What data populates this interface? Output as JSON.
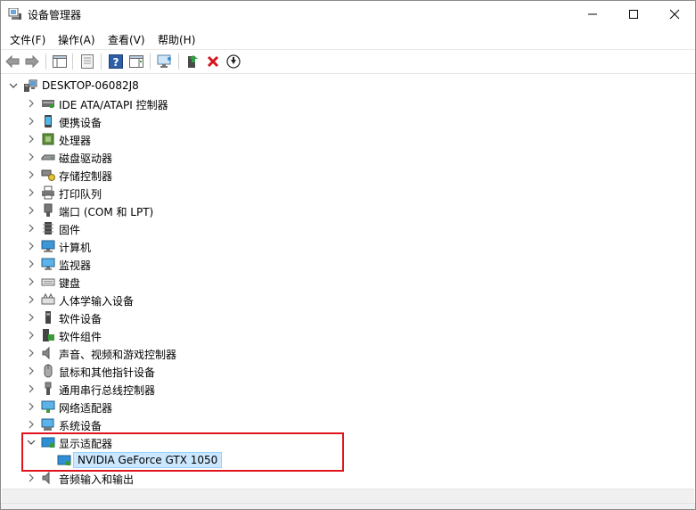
{
  "window": {
    "title": "设备管理器"
  },
  "menu": [
    "文件(F)",
    "操作(A)",
    "查看(V)",
    "帮助(H)"
  ],
  "tree": {
    "root": "DESKTOP-06082J8",
    "items": [
      {
        "label": "IDE ATA/ATAPI 控制器",
        "icon": "ide-controller-icon"
      },
      {
        "label": "便携设备",
        "icon": "portable-device-icon"
      },
      {
        "label": "处理器",
        "icon": "processor-icon"
      },
      {
        "label": "磁盘驱动器",
        "icon": "disk-drive-icon"
      },
      {
        "label": "存储控制器",
        "icon": "storage-controller-icon"
      },
      {
        "label": "打印队列",
        "icon": "printer-icon"
      },
      {
        "label": "端口 (COM 和 LPT)",
        "icon": "port-icon"
      },
      {
        "label": "固件",
        "icon": "firmware-icon"
      },
      {
        "label": "计算机",
        "icon": "computer-icon"
      },
      {
        "label": "监视器",
        "icon": "monitor-icon"
      },
      {
        "label": "键盘",
        "icon": "keyboard-icon"
      },
      {
        "label": "人体学输入设备",
        "icon": "hid-icon"
      },
      {
        "label": "软件设备",
        "icon": "software-device-icon"
      },
      {
        "label": "软件组件",
        "icon": "software-component-icon"
      },
      {
        "label": "声音、视频和游戏控制器",
        "icon": "sound-icon"
      },
      {
        "label": "鼠标和其他指针设备",
        "icon": "mouse-icon"
      },
      {
        "label": "通用串行总线控制器",
        "icon": "usb-icon"
      },
      {
        "label": "网络适配器",
        "icon": "network-adapter-icon"
      },
      {
        "label": "系统设备",
        "icon": "system-device-icon"
      }
    ],
    "expanded": {
      "label": "显示适配器",
      "icon": "display-adapter-icon"
    },
    "child": {
      "label": "NVIDIA GeForce GTX 1050",
      "icon": "gpu-icon"
    },
    "after": {
      "label": "音频输入和输出",
      "icon": "audio-io-icon"
    }
  },
  "colors": {
    "selection_bg": "#cce8ff",
    "highlight": "#e0141c"
  }
}
